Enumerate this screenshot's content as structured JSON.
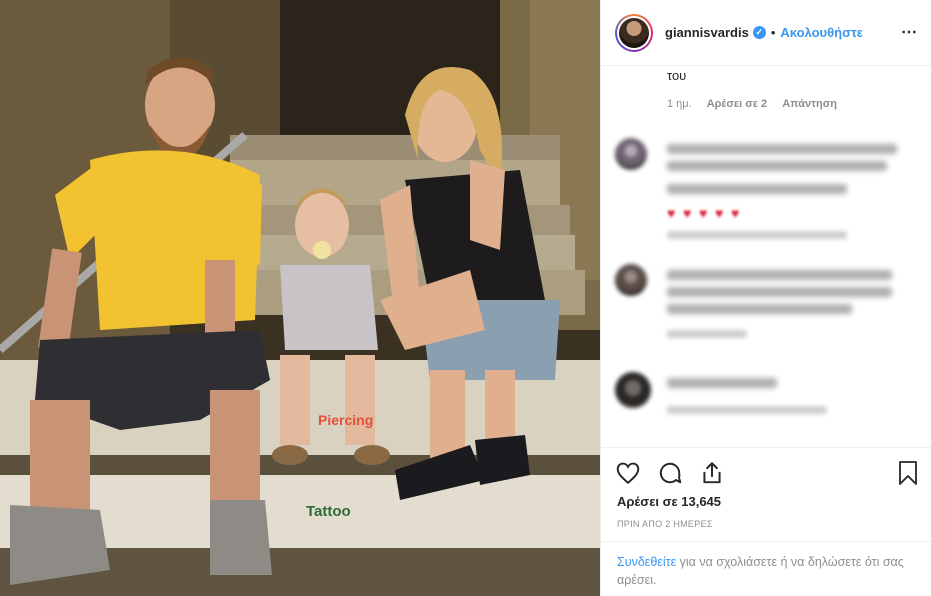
{
  "post": {
    "username": "giannisvardis",
    "verified_mark": "✓",
    "separator": "•",
    "follow_label": "Ακολουθήστε",
    "more_icon": "⋯"
  },
  "comments": {
    "visible_tail": {
      "text_tail": "του",
      "time": "1 ημ.",
      "likes": "Αρέσει σε 2",
      "reply": "Απάντηση"
    },
    "blurred_count": 3
  },
  "icons": [
    "heart-icon",
    "comment-icon",
    "share-icon",
    "bookmark-icon",
    "more-options-icon",
    "verified-badge-icon"
  ],
  "actions": {
    "likes_text": "Αρέσει σε 13,645",
    "timestamp": "ΠΡΙΝ ΑΠΟ 2 ΗΜΕΡΕΣ"
  },
  "login": {
    "link": "Συνδεθείτε",
    "rest": " για να σχολιάσετε ή να δηλώσετε ότι σας αρέσει."
  },
  "photo": {
    "wall_text_1": "Piercing",
    "wall_text_2": "Tattoo"
  },
  "colors": {
    "accent": "#3897f0",
    "text": "#262626",
    "muted": "#8e8e8e",
    "divider": "#efefef",
    "shirt_yellow": "#f2c230"
  }
}
